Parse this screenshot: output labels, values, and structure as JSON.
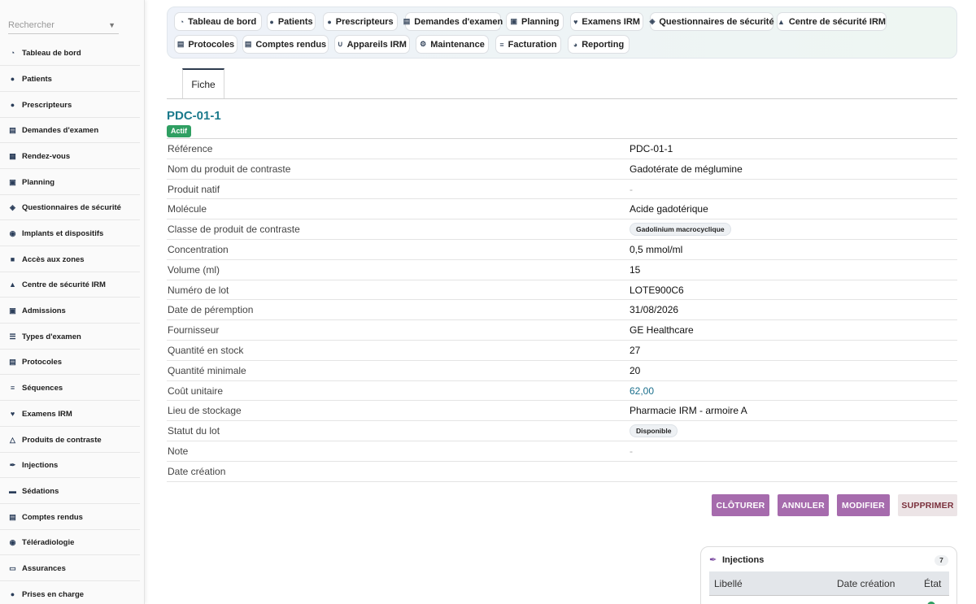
{
  "sidebar": {
    "search_placeholder": "Rechercher",
    "items": [
      {
        "label": "Tableau de bord",
        "icon": "dashboard-icon"
      },
      {
        "label": "Patients",
        "icon": "user-icon"
      },
      {
        "label": "Prescripteurs",
        "icon": "doctor-icon"
      },
      {
        "label": "Demandes d'examen",
        "icon": "file-icon"
      },
      {
        "label": "Rendez-vous",
        "icon": "calendar-icon"
      },
      {
        "label": "Planning",
        "icon": "calendar-check-icon"
      },
      {
        "label": "Questionnaires de sécurité",
        "icon": "shield-icon"
      },
      {
        "label": "Implants et dispositifs",
        "icon": "device-icon"
      },
      {
        "label": "Accès aux zones",
        "icon": "lock-icon"
      },
      {
        "label": "Centre de sécurité IRM",
        "icon": "warning-icon"
      },
      {
        "label": "Admissions",
        "icon": "clipboard-icon"
      },
      {
        "label": "Types d'examen",
        "icon": "list-icon"
      },
      {
        "label": "Protocoles",
        "icon": "notes-icon"
      },
      {
        "label": "Séquences",
        "icon": "sequence-icon"
      },
      {
        "label": "Examens IRM",
        "icon": "heartbeat-icon"
      },
      {
        "label": "Produits de contraste",
        "icon": "flask-icon"
      },
      {
        "label": "Injections",
        "icon": "syringe-icon"
      },
      {
        "label": "Sédations",
        "icon": "bed-icon"
      },
      {
        "label": "Comptes rendus",
        "icon": "report-icon"
      },
      {
        "label": "Téléradiologie",
        "icon": "satellite-icon"
      },
      {
        "label": "Assurances",
        "icon": "card-icon"
      },
      {
        "label": "Prises en charge",
        "icon": "circle-icon"
      }
    ]
  },
  "topnav": {
    "items": [
      {
        "label": "Tableau de bord",
        "icon": "dashboard-icon"
      },
      {
        "label": "Patients",
        "icon": "user-icon"
      },
      {
        "label": "Prescripteurs",
        "icon": "doctor-icon"
      },
      {
        "label": "Demandes d'examen",
        "icon": "file-icon"
      },
      {
        "label": "Planning",
        "icon": "calendar-check-icon"
      },
      {
        "label": "Examens IRM",
        "icon": "heartbeat-icon"
      },
      {
        "label": "Questionnaires de sécurité",
        "icon": "shield-icon"
      },
      {
        "label": "Centre de sécurité IRM",
        "icon": "warning-icon"
      },
      {
        "label": "Protocoles",
        "icon": "notes-icon"
      },
      {
        "label": "Comptes rendus",
        "icon": "report-icon"
      },
      {
        "label": "Appareils IRM",
        "icon": "magnet-icon"
      },
      {
        "label": "Maintenance",
        "icon": "gears-icon"
      },
      {
        "label": "Facturation",
        "icon": "invoice-icon"
      },
      {
        "label": "Reporting",
        "icon": "chart-pie-icon"
      }
    ]
  },
  "tabs": {
    "fiche": "Fiche"
  },
  "record": {
    "title": "PDC-01-1",
    "status_badge": "Actif",
    "fields": [
      {
        "label": "Référence",
        "value": "PDC-01-1",
        "kind": "text"
      },
      {
        "label": "Nom du produit de contraste",
        "value": "Gadotérate de méglumine",
        "kind": "text"
      },
      {
        "label": "Produit natif",
        "value": "-",
        "kind": "dash"
      },
      {
        "label": "Molécule",
        "value": "Acide gadotérique",
        "kind": "text"
      },
      {
        "label": "Classe de produit de contraste",
        "value": "Gadolinium macrocyclique",
        "kind": "chip"
      },
      {
        "label": "Concentration",
        "value": "0,5 mmol/ml",
        "kind": "text"
      },
      {
        "label": "Volume (ml)",
        "value": "15",
        "kind": "text"
      },
      {
        "label": "Numéro de lot",
        "value": "LOTE900C6",
        "kind": "text"
      },
      {
        "label": "Date de péremption",
        "value": "31/08/2026",
        "kind": "text"
      },
      {
        "label": "Fournisseur",
        "value": "GE Healthcare",
        "kind": "text"
      },
      {
        "label": "Quantité en stock",
        "value": "27",
        "kind": "text"
      },
      {
        "label": "Quantité minimale",
        "value": "20",
        "kind": "text"
      },
      {
        "label": "Coût unitaire",
        "value": "62,00",
        "kind": "link"
      },
      {
        "label": "Lieu de stockage",
        "value": "Pharmacie IRM - armoire A",
        "kind": "text"
      },
      {
        "label": "Statut du lot",
        "value": "Disponible",
        "kind": "chip"
      },
      {
        "label": "Note",
        "value": "-",
        "kind": "dash"
      },
      {
        "label": "Date création",
        "value": "",
        "kind": "text"
      }
    ]
  },
  "actions": {
    "close": "CLÔTURER",
    "cancel": "ANNULER",
    "edit": "MODIFIER",
    "delete": "SUPPRIMER"
  },
  "injections": {
    "title": "Injections",
    "count": "7",
    "columns": [
      "Libellé",
      "Date création",
      "État"
    ]
  },
  "colors": {
    "accent": "#1b7a8c",
    "action_purple": "#a66bad",
    "status_green": "#2f9f62"
  }
}
